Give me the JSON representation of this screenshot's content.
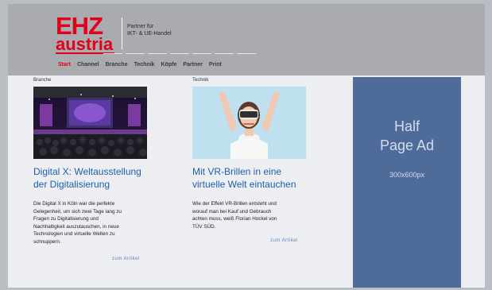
{
  "logo": {
    "top": "EHZ",
    "bottom": "austria"
  },
  "tagline": {
    "line1": "Partner für",
    "line2": "IKT- & UE-Handel"
  },
  "nav": {
    "items": [
      "Start",
      "Channel",
      "Branche",
      "Technik",
      "Köpfe",
      "Partner",
      "Print"
    ],
    "active": "Start"
  },
  "articles": [
    {
      "category": "Branche",
      "title_line1": "Digital X: Weltausstellung",
      "title_line2": "der Digitalisierung",
      "text_lines": [
        "Die Digital X in Köln war die perfekte",
        "Gelegenheit, um sich zwei Tage lang zu",
        "Fragen zu Digitalisierung und",
        "Nachhaltigkeit auszutauschen, in neue",
        "Technologien und virtuelle Welten zu",
        "schnuppern."
      ],
      "link": "zum Artikel"
    },
    {
      "category": "Technik",
      "title_line1": "Mit VR-Brillen in eine",
      "title_line2": "virtuelle Welt eintauchen",
      "text_lines": [
        "Wie der Effekt VR-Brillen entsteht und",
        "worauf man bei Kauf und Gebrauch",
        "achten muss, weiß Florian Hockel von",
        "TÜV SÜD."
      ],
      "link": "zum Artikel"
    }
  ],
  "ad": {
    "line1": "Half",
    "line2": "Page Ad",
    "size": "300x600px"
  },
  "colors": {
    "brand_red": "#e2001a",
    "link_blue": "#1f5fa8",
    "ad_blue": "#4f6b9a"
  }
}
